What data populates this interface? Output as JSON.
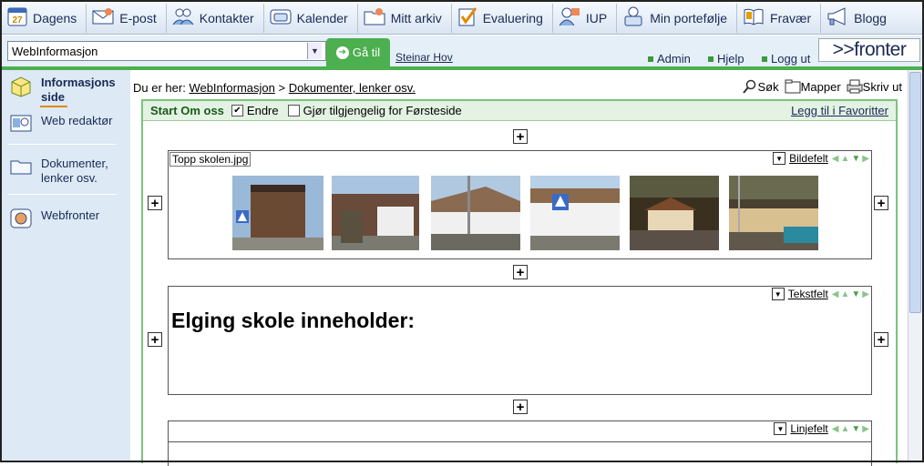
{
  "nav": {
    "items": [
      {
        "label": "Dagens",
        "icon": "calendar-27-icon"
      },
      {
        "label": "E-post",
        "icon": "envelope-icon"
      },
      {
        "label": "Kontakter",
        "icon": "contacts-icon"
      },
      {
        "label": "Kalender",
        "icon": "calendar-icon"
      },
      {
        "label": "Mitt arkiv",
        "icon": "folder-icon"
      },
      {
        "label": "Evaluering",
        "icon": "checkmark-icon"
      },
      {
        "label": "IUP",
        "icon": "user-icon"
      },
      {
        "label": "Min portefølje",
        "icon": "portfolio-icon"
      },
      {
        "label": "Fravær",
        "icon": "book-icon"
      },
      {
        "label": "Blogg",
        "icon": "megaphone-icon"
      }
    ],
    "calendar_day": "27"
  },
  "toolbar": {
    "room_select": "WebInformasjon",
    "go_button": "Gå til",
    "username": "Steinar Hov",
    "links": [
      "Admin",
      "Hjelp",
      "Logg ut"
    ],
    "logo": ">>fronter"
  },
  "sidebar": {
    "items": [
      {
        "label": "Informasjons side"
      },
      {
        "label": "Web redaktør"
      },
      {
        "label": "Dokumenter, lenker osv."
      },
      {
        "label": "Webfronter"
      }
    ]
  },
  "breadcrumb": {
    "prefix": "Du er her:",
    "items": [
      "WebInformasjon",
      "Dokumenter, lenker osv."
    ],
    "separator": ">"
  },
  "tools": [
    "Søk",
    "Mapper",
    "Skriv ut"
  ],
  "panel": {
    "title": "Start Om oss",
    "edit_label": "Endre",
    "frontpage_label": "Gjør tilgjengelig for Førsteside",
    "favorite_link": "Legg til i Favoritter"
  },
  "blocks": {
    "image": {
      "filename": "Topp skolen.jpg",
      "type_label": "Bildefelt"
    },
    "text": {
      "type_label": "Tekstfelt",
      "heading": "Elging skole inneholder:"
    },
    "line": {
      "type_label": "Linjefelt"
    }
  },
  "colors": {
    "accent_green": "#4caf50",
    "nav_text": "#1a2a55",
    "sidebar_bg": "#dde9f5"
  }
}
